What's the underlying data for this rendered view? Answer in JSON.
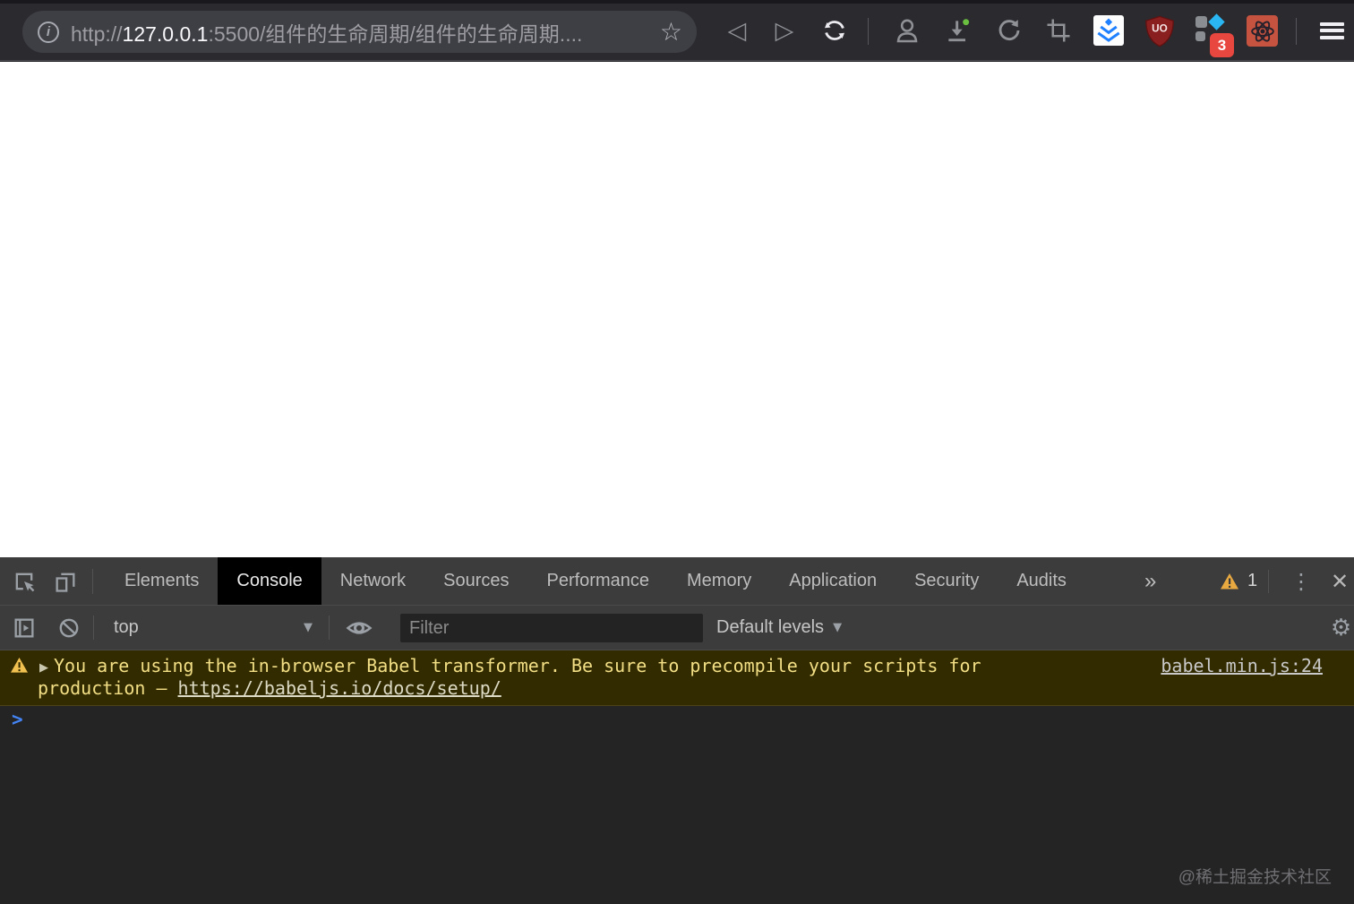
{
  "browser": {
    "url_scheme": "http://",
    "url_host": "127.0.0.1",
    "url_path": ":5500/组件的生命周期/组件的生命周期....",
    "extensions": {
      "ublock_text": "UO",
      "badge_count": "3"
    }
  },
  "icons": {
    "info": "i",
    "back": "◁",
    "forward": "▷",
    "star": "☆",
    "more_tabs": "»",
    "kebab": "⋮",
    "close": "✕",
    "dropdown_arrow": "▼",
    "expander": "▶",
    "gear": "⚙",
    "prompt_chevron": ">"
  },
  "devtools": {
    "tabs": [
      "Elements",
      "Console",
      "Network",
      "Sources",
      "Performance",
      "Memory",
      "Application",
      "Security",
      "Audits"
    ],
    "active_tab": "Console",
    "warning_count": "1",
    "toolbar": {
      "context_selector": "top",
      "filter_placeholder": "Filter",
      "log_level": "Default levels"
    },
    "console": {
      "warning_line1": "You are using the in-browser Babel transformer. Be sure to precompile your scripts for",
      "warning_line2_prefix": "production – ",
      "warning_link": "https://babeljs.io/docs/setup/",
      "source_link": "babel.min.js:24"
    }
  },
  "watermark": "@稀土掘金技术社区",
  "colors": {
    "accent_blue": "#4383f3",
    "warning_bg": "#332b00",
    "warning_text": "#f2df85",
    "juejin_blue": "#1e80ff",
    "ublock_red": "#8a1f1f",
    "react_bg": "#c65340",
    "badge_red": "#e8473f"
  }
}
